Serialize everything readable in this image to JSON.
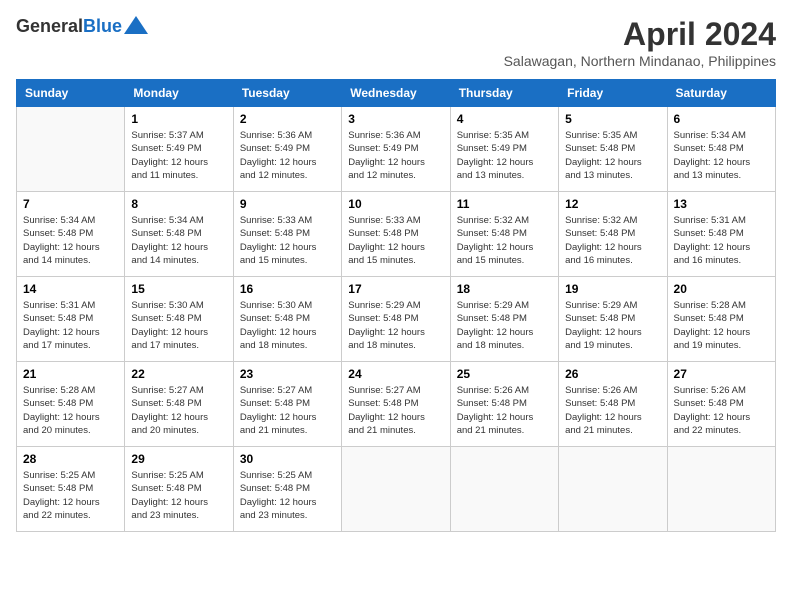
{
  "header": {
    "logo_general": "General",
    "logo_blue": "Blue",
    "month_title": "April 2024",
    "location": "Salawagan, Northern Mindanao, Philippines"
  },
  "calendar": {
    "days_of_week": [
      "Sunday",
      "Monday",
      "Tuesday",
      "Wednesday",
      "Thursday",
      "Friday",
      "Saturday"
    ],
    "weeks": [
      [
        {
          "day": "",
          "info": ""
        },
        {
          "day": "1",
          "info": "Sunrise: 5:37 AM\nSunset: 5:49 PM\nDaylight: 12 hours\nand 11 minutes."
        },
        {
          "day": "2",
          "info": "Sunrise: 5:36 AM\nSunset: 5:49 PM\nDaylight: 12 hours\nand 12 minutes."
        },
        {
          "day": "3",
          "info": "Sunrise: 5:36 AM\nSunset: 5:49 PM\nDaylight: 12 hours\nand 12 minutes."
        },
        {
          "day": "4",
          "info": "Sunrise: 5:35 AM\nSunset: 5:49 PM\nDaylight: 12 hours\nand 13 minutes."
        },
        {
          "day": "5",
          "info": "Sunrise: 5:35 AM\nSunset: 5:48 PM\nDaylight: 12 hours\nand 13 minutes."
        },
        {
          "day": "6",
          "info": "Sunrise: 5:34 AM\nSunset: 5:48 PM\nDaylight: 12 hours\nand 13 minutes."
        }
      ],
      [
        {
          "day": "7",
          "info": "Sunrise: 5:34 AM\nSunset: 5:48 PM\nDaylight: 12 hours\nand 14 minutes."
        },
        {
          "day": "8",
          "info": "Sunrise: 5:34 AM\nSunset: 5:48 PM\nDaylight: 12 hours\nand 14 minutes."
        },
        {
          "day": "9",
          "info": "Sunrise: 5:33 AM\nSunset: 5:48 PM\nDaylight: 12 hours\nand 15 minutes."
        },
        {
          "day": "10",
          "info": "Sunrise: 5:33 AM\nSunset: 5:48 PM\nDaylight: 12 hours\nand 15 minutes."
        },
        {
          "day": "11",
          "info": "Sunrise: 5:32 AM\nSunset: 5:48 PM\nDaylight: 12 hours\nand 15 minutes."
        },
        {
          "day": "12",
          "info": "Sunrise: 5:32 AM\nSunset: 5:48 PM\nDaylight: 12 hours\nand 16 minutes."
        },
        {
          "day": "13",
          "info": "Sunrise: 5:31 AM\nSunset: 5:48 PM\nDaylight: 12 hours\nand 16 minutes."
        }
      ],
      [
        {
          "day": "14",
          "info": "Sunrise: 5:31 AM\nSunset: 5:48 PM\nDaylight: 12 hours\nand 17 minutes."
        },
        {
          "day": "15",
          "info": "Sunrise: 5:30 AM\nSunset: 5:48 PM\nDaylight: 12 hours\nand 17 minutes."
        },
        {
          "day": "16",
          "info": "Sunrise: 5:30 AM\nSunset: 5:48 PM\nDaylight: 12 hours\nand 18 minutes."
        },
        {
          "day": "17",
          "info": "Sunrise: 5:29 AM\nSunset: 5:48 PM\nDaylight: 12 hours\nand 18 minutes."
        },
        {
          "day": "18",
          "info": "Sunrise: 5:29 AM\nSunset: 5:48 PM\nDaylight: 12 hours\nand 18 minutes."
        },
        {
          "day": "19",
          "info": "Sunrise: 5:29 AM\nSunset: 5:48 PM\nDaylight: 12 hours\nand 19 minutes."
        },
        {
          "day": "20",
          "info": "Sunrise: 5:28 AM\nSunset: 5:48 PM\nDaylight: 12 hours\nand 19 minutes."
        }
      ],
      [
        {
          "day": "21",
          "info": "Sunrise: 5:28 AM\nSunset: 5:48 PM\nDaylight: 12 hours\nand 20 minutes."
        },
        {
          "day": "22",
          "info": "Sunrise: 5:27 AM\nSunset: 5:48 PM\nDaylight: 12 hours\nand 20 minutes."
        },
        {
          "day": "23",
          "info": "Sunrise: 5:27 AM\nSunset: 5:48 PM\nDaylight: 12 hours\nand 21 minutes."
        },
        {
          "day": "24",
          "info": "Sunrise: 5:27 AM\nSunset: 5:48 PM\nDaylight: 12 hours\nand 21 minutes."
        },
        {
          "day": "25",
          "info": "Sunrise: 5:26 AM\nSunset: 5:48 PM\nDaylight: 12 hours\nand 21 minutes."
        },
        {
          "day": "26",
          "info": "Sunrise: 5:26 AM\nSunset: 5:48 PM\nDaylight: 12 hours\nand 21 minutes."
        },
        {
          "day": "27",
          "info": "Sunrise: 5:26 AM\nSunset: 5:48 PM\nDaylight: 12 hours\nand 22 minutes."
        }
      ],
      [
        {
          "day": "28",
          "info": "Sunrise: 5:25 AM\nSunset: 5:48 PM\nDaylight: 12 hours\nand 22 minutes."
        },
        {
          "day": "29",
          "info": "Sunrise: 5:25 AM\nSunset: 5:48 PM\nDaylight: 12 hours\nand 23 minutes."
        },
        {
          "day": "30",
          "info": "Sunrise: 5:25 AM\nSunset: 5:48 PM\nDaylight: 12 hours\nand 23 minutes."
        },
        {
          "day": "",
          "info": ""
        },
        {
          "day": "",
          "info": ""
        },
        {
          "day": "",
          "info": ""
        },
        {
          "day": "",
          "info": ""
        }
      ]
    ]
  }
}
